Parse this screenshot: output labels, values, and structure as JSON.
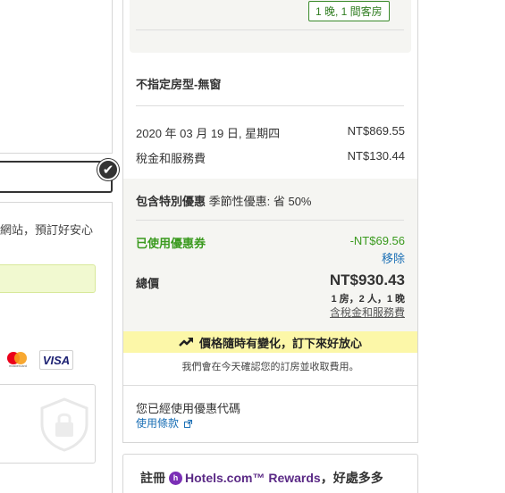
{
  "left": {
    "partial_notice": "網站，預訂好安心",
    "card_logos": [
      "mastercard-logo",
      "visa-logo"
    ],
    "visa_label": "VISA",
    "mastercard_label": "mastercard"
  },
  "summary": {
    "rooms_badge": "1 晚, 1 間客房",
    "room_type": "不指定房型-無窗",
    "lines": [
      {
        "label": "2020 年 03 月 19 日, 星期四",
        "value": "NT$869.55"
      },
      {
        "label": "稅金和服務費",
        "value": "NT$130.44"
      }
    ],
    "deal_prefix": "包含特別優惠",
    "deal_text": " 季節性優惠: 省 50%",
    "coupon_label": "已使用優惠券",
    "coupon_value": "-NT$69.56",
    "remove_label": "移除",
    "total_label": "總價",
    "total_value": "NT$930.43",
    "total_sub": "1 房，2 人，1 晚",
    "tax_note": "含稅金和服務費",
    "price_alert": "價格隨時有變化，訂下來好放心",
    "confirm_note": "我們會在今天確認您的訂房並收取費用。",
    "used_promo": "您已經使用優惠代碼",
    "terms_label": "使用條款"
  },
  "rewards": {
    "prefix": "註冊",
    "brand": "Hotels.com™ Rewards",
    "suffix": "，好處多多"
  },
  "colors": {
    "green": "#3a9a1e",
    "link": "#1a6fb5",
    "yellow": "#fcf7a8",
    "panel_gray": "#f5f5f2",
    "brand_purple": "#5b2a86"
  }
}
